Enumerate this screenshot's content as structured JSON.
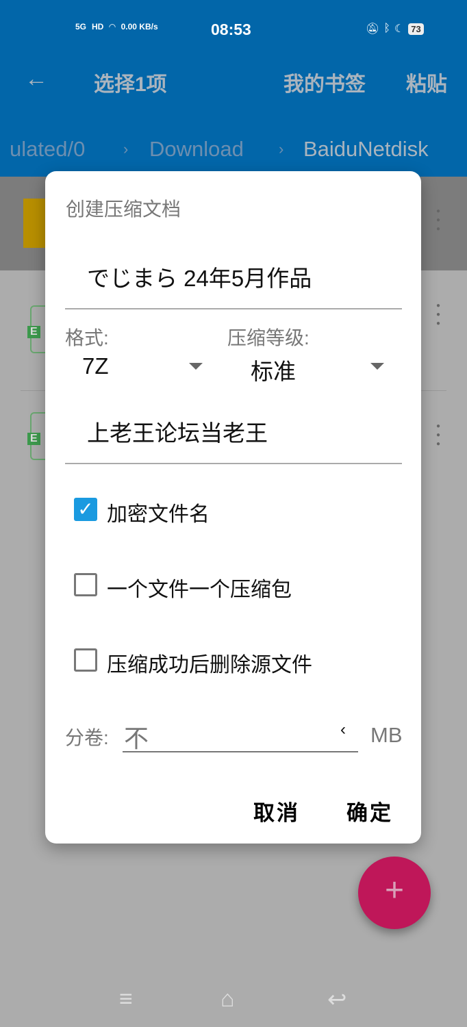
{
  "status_bar": {
    "network": "5G",
    "hd": "HD",
    "speed": "0.00 KB/s",
    "time": "08:53",
    "battery": "73"
  },
  "toolbar": {
    "back_icon": "arrow-left",
    "title": "选择1项",
    "bookmarks": "我的书签",
    "paste": "粘贴"
  },
  "breadcrumb": [
    "ulated/0",
    "Download",
    "BaiduNetdisk"
  ],
  "file_list": {
    "badges": [
      "E",
      "E"
    ]
  },
  "dialog": {
    "title": "创建压缩文档",
    "archive_name": "でじまら 24年5月作品",
    "format_label": "格式:",
    "format_value": "7Z",
    "level_label": "压缩等级:",
    "level_value": "标准",
    "password": "上老王论坛当老王",
    "checkboxes": [
      {
        "label": "加密文件名",
        "checked": true
      },
      {
        "label": "一个文件一个压缩包",
        "checked": false
      },
      {
        "label": "压缩成功后删除源文件",
        "checked": false
      }
    ],
    "split_label": "分卷:",
    "split_value": "不",
    "split_unit": "MB",
    "cancel": "取消",
    "ok": "确定"
  },
  "fab": {
    "icon": "plus"
  },
  "colors": {
    "header": "#0266a9",
    "accent": "#1a9ae0",
    "fab": "#bf1759"
  }
}
